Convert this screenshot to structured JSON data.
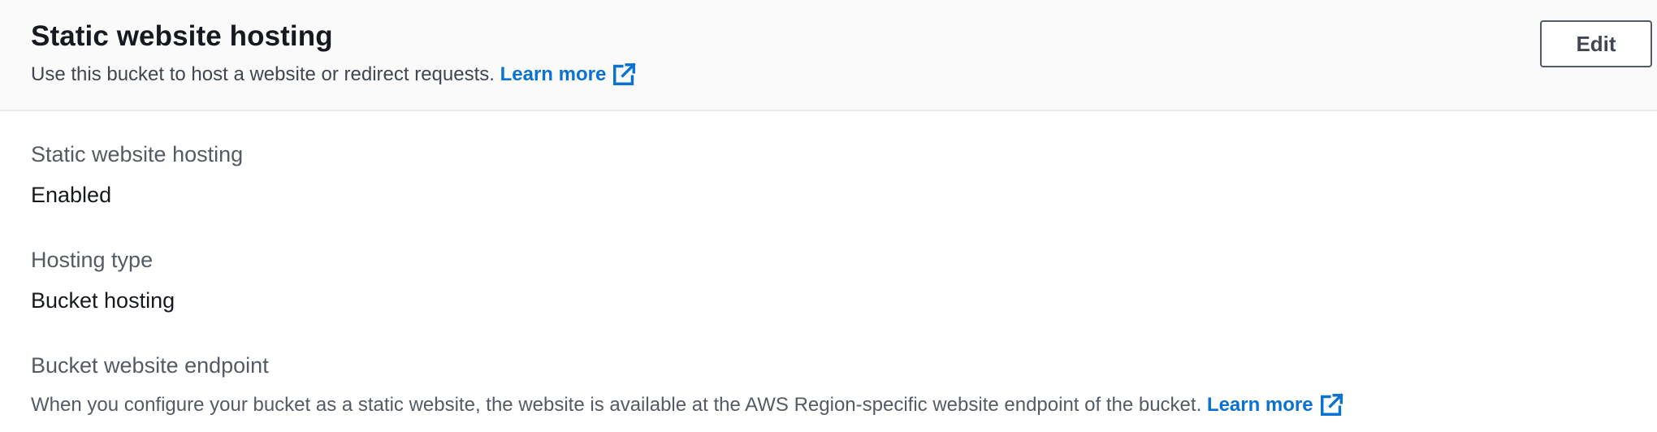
{
  "header": {
    "title": "Static website hosting",
    "description": "Use this bucket to host a website or redirect requests.",
    "learn_more_label": "Learn more",
    "edit_label": "Edit"
  },
  "fields": {
    "hosting_status": {
      "label": "Static website hosting",
      "value": "Enabled"
    },
    "hosting_type": {
      "label": "Hosting type",
      "value": "Bucket hosting"
    },
    "endpoint": {
      "label": "Bucket website endpoint",
      "description": "When you configure your bucket as a static website, the website is available at the AWS Region-specific website endpoint of the bucket.",
      "learn_more_label": "Learn more"
    }
  },
  "icons": {
    "external_link": "external-link-icon"
  },
  "colors": {
    "link": "#0972d3",
    "header_background": "#fafafa",
    "title": "#16191f",
    "secondary_text": "#545b64"
  }
}
